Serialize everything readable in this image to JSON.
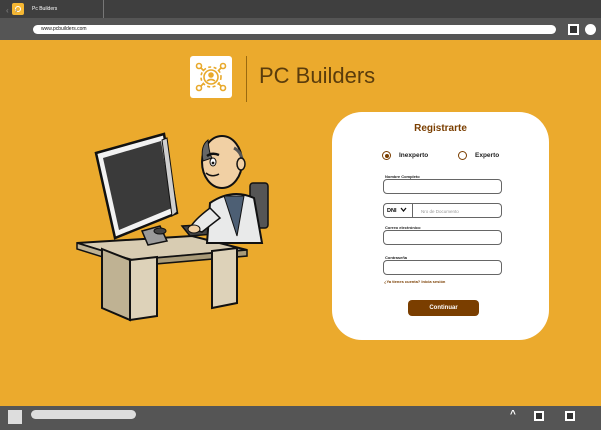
{
  "tab": {
    "title": "Pc Builders"
  },
  "browser": {
    "url": "www.pcbuilders.com",
    "nav_arrows": "‹ ›"
  },
  "brand": {
    "name": "PC Builders"
  },
  "form": {
    "title": "Registrarte",
    "options": [
      {
        "label": "Inexperto",
        "selected": true
      },
      {
        "label": "Experto",
        "selected": false
      }
    ],
    "full_name_label": "Nombre Completo",
    "doc_type": "DNI",
    "doc_placeholder": "Nro de Documento",
    "email_label": "Correo electrónico",
    "password_label": "Contraseña",
    "login_link": "¿Ya tienes cuenta? Inicia sesión",
    "submit_label": "Continuar"
  },
  "taskbar": {
    "chevron": "^"
  },
  "colors": {
    "accent": "#7a3e00",
    "background": "#ebaa2d",
    "brand_text": "#5a3c0c"
  }
}
